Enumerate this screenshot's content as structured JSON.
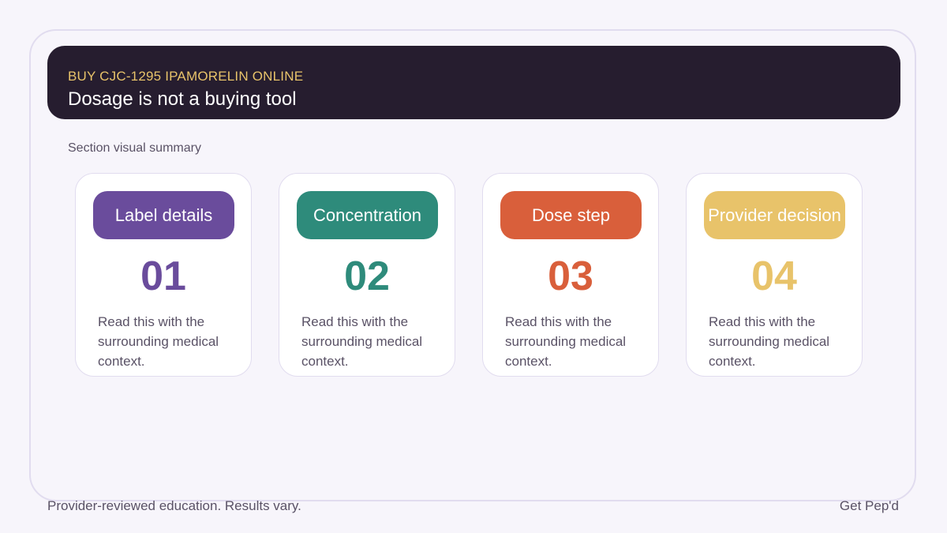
{
  "header": {
    "kicker": "BUY CJC-1295 IPAMORELIN ONLINE",
    "title": "Dosage is not a buying tool"
  },
  "section_label": "Section visual summary",
  "cards": [
    {
      "label": "Label details",
      "number": "01",
      "text": "Read this with the surrounding medical context.",
      "color": "#6a4c9c"
    },
    {
      "label": "Concentration",
      "number": "02",
      "text": "Read this with the surrounding medical context.",
      "color": "#2e8b7b"
    },
    {
      "label": "Dose step",
      "number": "03",
      "text": "Read this with the surrounding medical context.",
      "color": "#d95f3b"
    },
    {
      "label": "Provider decision",
      "number": "04",
      "text": "Read this with the surrounding medical context.",
      "color": "#e8c36a"
    }
  ],
  "footer": {
    "left": "Provider-reviewed education. Results vary.",
    "right": "Get Pep'd"
  }
}
